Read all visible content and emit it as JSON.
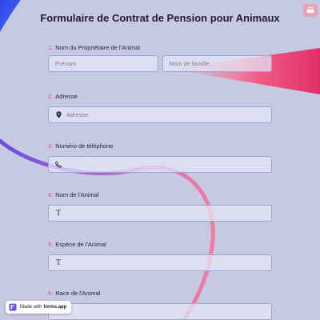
{
  "form": {
    "title": "Formulaire de Contrat de Pension pour Animaux",
    "fields": [
      {
        "number": "1.",
        "label": "Nom du Propriétaire de l'Animal",
        "first_placeholder": "Prénom",
        "last_placeholder": "Nom de famille"
      },
      {
        "number": "2.",
        "label": "Adresse",
        "placeholder": "Adresse",
        "icon": "location-pin-icon"
      },
      {
        "number": "3.",
        "label": "Numéro de téléphone",
        "icon": "phone-icon"
      },
      {
        "number": "4.",
        "label": "Nom de l'Animal",
        "icon": "text-icon"
      },
      {
        "number": "5.",
        "label": "Espèce de l'Animal",
        "icon": "text-icon"
      },
      {
        "number": "6.",
        "label": "Race de l'Animal"
      }
    ]
  },
  "badge": {
    "prefix": "Made with",
    "brand": "forms.app"
  },
  "colors": {
    "background": "#c6c9e2",
    "accent": "#e0506f",
    "input_border": "#9ea5dd",
    "corner_button": "#e6a3b3"
  }
}
